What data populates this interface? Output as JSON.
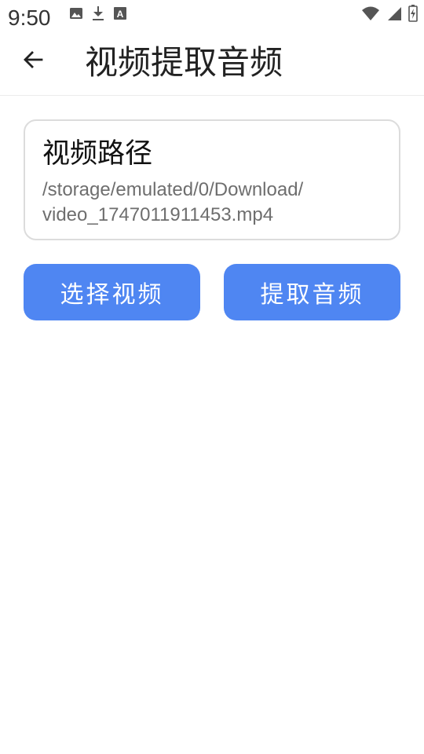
{
  "status_bar": {
    "time": "9:50",
    "left_icons": [
      "image-icon",
      "download-icon",
      "font-icon"
    ],
    "right_icons": [
      "wifi-icon",
      "signal-icon",
      "battery-icon"
    ]
  },
  "toolbar": {
    "back_icon": "arrow-left-icon",
    "title": "视频提取音频"
  },
  "path_card": {
    "label": "视频路径",
    "value": "/storage/emulated/0/Download/\nvideo_1747011911453.mp4"
  },
  "buttons": {
    "select_label": "选择视频",
    "extract_label": "提取音频"
  },
  "colors": {
    "accent": "#4f86f2",
    "card_border": "#dcdcdc",
    "path_text": "#6e6e6e"
  }
}
